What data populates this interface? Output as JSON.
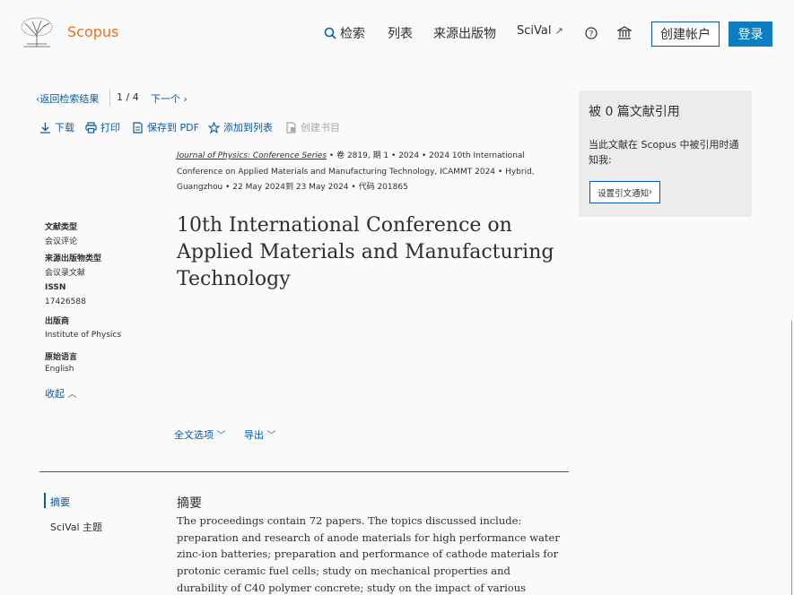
{
  "header": {
    "logo_text": "Scopus",
    "nav_search": "检索",
    "nav_list": "列表",
    "nav_source": "来源出版物",
    "nav_scival": "SciVal",
    "create_account": "创建帐户",
    "login": "登录"
  },
  "toolbar": {
    "back": "返回检索结果",
    "pager": "1 / 4",
    "next": "下一个",
    "download": "下载",
    "print": "打印",
    "save_pdf": "保存到 PDF",
    "add_list": "添加到列表",
    "create_bib": "创建书目"
  },
  "source": {
    "journal": "Journal of Physics: Conference Series",
    "volume": "卷 2819, 期 1",
    "year": "2024",
    "conference": "2024 10th International Conference on Applied Materials and Manufacturing Technology, ICAMMT 2024",
    "location": "Hybrid, Guangzhou",
    "dates": "22 May 2024到 23 May 2024",
    "code": "代码 201865"
  },
  "title": "10th International Conference on Applied Materials and Manufacturing Technology",
  "metadata": [
    {
      "label": "文献类型",
      "value": "会议评论"
    },
    {
      "label": "来源出版物类型",
      "value": "会议录文献"
    },
    {
      "label": "ISSN",
      "value": "17426588"
    },
    {
      "label": "出版商",
      "value": "Institute of Physics"
    },
    {
      "label": "原始语言",
      "value": "English"
    }
  ],
  "collapse": "收起",
  "fulltext_options": "全文选项",
  "export": "导出",
  "toc": {
    "abstract": "摘要",
    "scival_topics": "SciVal 主题"
  },
  "abstract": {
    "heading": "摘要",
    "text": "The proceedings contain 72 papers. The topics discussed include: preparation and research of anode materials for high performance water zinc-ion batteries; preparation and performance of cathode materials for protonic ceramic fuel cells; study on mechanical properties and durability of C40 polymer concrete; study on the impact of various braiding methods on the properties of class p membrane"
  },
  "citations": {
    "title": "被 0 篇文献引用",
    "description": "当此文献在 Scopus 中被引用时通知我:",
    "button": "设置引文通知"
  },
  "colors": {
    "accent": "#0c5aa6",
    "brand_orange": "#e9711c",
    "login_bg": "#0c7dbe"
  }
}
